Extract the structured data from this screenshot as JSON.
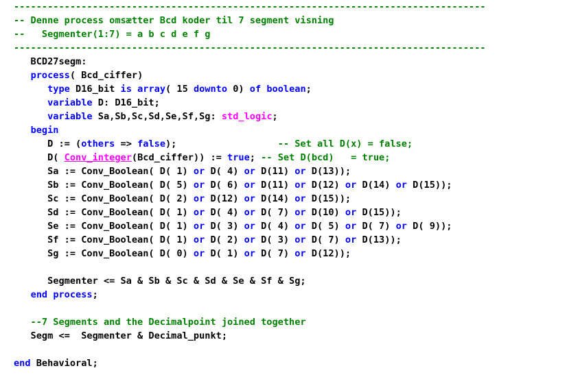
{
  "colors": {
    "plain": "#000000",
    "comment": "#008000",
    "keyword": "#0000ff",
    "type": "#ff00ff",
    "func": "#ff00ff"
  },
  "code_lines": [
    [
      {
        "t": "------------------------------------------------------------------------------------",
        "k": "comment"
      }
    ],
    [
      {
        "t": "-- Denne process omsætter Bcd koder til 7 segment visning",
        "k": "comment"
      }
    ],
    [
      {
        "t": "--   Segmenter(1:7) = a b c d e f g",
        "k": "comment"
      }
    ],
    [
      {
        "t": "------------------------------------------------------------------------------------",
        "k": "comment"
      }
    ],
    [
      {
        "t": "   BCD27segm:",
        "k": "plain"
      }
    ],
    [
      {
        "t": "   ",
        "k": "plain"
      },
      {
        "t": "process",
        "k": "keyword"
      },
      {
        "t": "( Bcd_ciffer)",
        "k": "plain"
      }
    ],
    [
      {
        "t": "      ",
        "k": "plain"
      },
      {
        "t": "type",
        "k": "keyword"
      },
      {
        "t": " D16_bit ",
        "k": "plain"
      },
      {
        "t": "is",
        "k": "keyword"
      },
      {
        "t": " ",
        "k": "plain"
      },
      {
        "t": "array",
        "k": "keyword"
      },
      {
        "t": "( 15 ",
        "k": "plain"
      },
      {
        "t": "downto",
        "k": "keyword"
      },
      {
        "t": " 0) ",
        "k": "plain"
      },
      {
        "t": "of",
        "k": "keyword"
      },
      {
        "t": " ",
        "k": "plain"
      },
      {
        "t": "boolean",
        "k": "keyword"
      },
      {
        "t": ";",
        "k": "plain"
      }
    ],
    [
      {
        "t": "      ",
        "k": "plain"
      },
      {
        "t": "variable",
        "k": "keyword"
      },
      {
        "t": " D: D16_bit;",
        "k": "plain"
      }
    ],
    [
      {
        "t": "      ",
        "k": "plain"
      },
      {
        "t": "variable",
        "k": "keyword"
      },
      {
        "t": " Sa,Sb,Sc,Sd,Se,Sf,Sg: ",
        "k": "plain"
      },
      {
        "t": "std_logic",
        "k": "type"
      },
      {
        "t": ";",
        "k": "plain"
      }
    ],
    [
      {
        "t": "   ",
        "k": "plain"
      },
      {
        "t": "begin",
        "k": "keyword"
      }
    ],
    [
      {
        "t": "      D := (",
        "k": "plain"
      },
      {
        "t": "others",
        "k": "keyword"
      },
      {
        "t": " => ",
        "k": "plain"
      },
      {
        "t": "false",
        "k": "keyword"
      },
      {
        "t": ");                  ",
        "k": "plain"
      },
      {
        "t": "-- Set all D(x) = false;",
        "k": "comment"
      }
    ],
    [
      {
        "t": "      D( ",
        "k": "plain"
      },
      {
        "t": "Conv_integer",
        "k": "func"
      },
      {
        "t": "(Bcd_ciffer)) := ",
        "k": "plain"
      },
      {
        "t": "true",
        "k": "keyword"
      },
      {
        "t": "; ",
        "k": "plain"
      },
      {
        "t": "-- Set D(bcd)   = true;",
        "k": "comment"
      }
    ],
    [
      {
        "t": "      Sa := Conv_Boolean( D( 1) ",
        "k": "plain"
      },
      {
        "t": "or",
        "k": "keyword"
      },
      {
        "t": " D( 4) ",
        "k": "plain"
      },
      {
        "t": "or",
        "k": "keyword"
      },
      {
        "t": " D(11) ",
        "k": "plain"
      },
      {
        "t": "or",
        "k": "keyword"
      },
      {
        "t": " D(13));",
        "k": "plain"
      }
    ],
    [
      {
        "t": "      Sb := Conv_Boolean( D( 5) ",
        "k": "plain"
      },
      {
        "t": "or",
        "k": "keyword"
      },
      {
        "t": " D( 6) ",
        "k": "plain"
      },
      {
        "t": "or",
        "k": "keyword"
      },
      {
        "t": " D(11) ",
        "k": "plain"
      },
      {
        "t": "or",
        "k": "keyword"
      },
      {
        "t": " D(12) ",
        "k": "plain"
      },
      {
        "t": "or",
        "k": "keyword"
      },
      {
        "t": " D(14) ",
        "k": "plain"
      },
      {
        "t": "or",
        "k": "keyword"
      },
      {
        "t": " D(15));",
        "k": "plain"
      }
    ],
    [
      {
        "t": "      Sc := Conv_Boolean( D( 2) ",
        "k": "plain"
      },
      {
        "t": "or",
        "k": "keyword"
      },
      {
        "t": " D(12) ",
        "k": "plain"
      },
      {
        "t": "or",
        "k": "keyword"
      },
      {
        "t": " D(14) ",
        "k": "plain"
      },
      {
        "t": "or",
        "k": "keyword"
      },
      {
        "t": " D(15));",
        "k": "plain"
      }
    ],
    [
      {
        "t": "      Sd := Conv_Boolean( D( 1) ",
        "k": "plain"
      },
      {
        "t": "or",
        "k": "keyword"
      },
      {
        "t": " D( 4) ",
        "k": "plain"
      },
      {
        "t": "or",
        "k": "keyword"
      },
      {
        "t": " D( 7) ",
        "k": "plain"
      },
      {
        "t": "or",
        "k": "keyword"
      },
      {
        "t": " D(10) ",
        "k": "plain"
      },
      {
        "t": "or",
        "k": "keyword"
      },
      {
        "t": " D(15));",
        "k": "plain"
      }
    ],
    [
      {
        "t": "      Se := Conv_Boolean( D( 1) ",
        "k": "plain"
      },
      {
        "t": "or",
        "k": "keyword"
      },
      {
        "t": " D( 3) ",
        "k": "plain"
      },
      {
        "t": "or",
        "k": "keyword"
      },
      {
        "t": " D( 4) ",
        "k": "plain"
      },
      {
        "t": "or",
        "k": "keyword"
      },
      {
        "t": " D( 5) ",
        "k": "plain"
      },
      {
        "t": "or",
        "k": "keyword"
      },
      {
        "t": " D( 7) ",
        "k": "plain"
      },
      {
        "t": "or",
        "k": "keyword"
      },
      {
        "t": " D( 9));",
        "k": "plain"
      }
    ],
    [
      {
        "t": "      Sf := Conv_Boolean( D( 1) ",
        "k": "plain"
      },
      {
        "t": "or",
        "k": "keyword"
      },
      {
        "t": " D( 2) ",
        "k": "plain"
      },
      {
        "t": "or",
        "k": "keyword"
      },
      {
        "t": " D( 3) ",
        "k": "plain"
      },
      {
        "t": "or",
        "k": "keyword"
      },
      {
        "t": " D( 7) ",
        "k": "plain"
      },
      {
        "t": "or",
        "k": "keyword"
      },
      {
        "t": " D(13));",
        "k": "plain"
      }
    ],
    [
      {
        "t": "      Sg := Conv_Boolean( D( 0) ",
        "k": "plain"
      },
      {
        "t": "or",
        "k": "keyword"
      },
      {
        "t": " D( 1) ",
        "k": "plain"
      },
      {
        "t": "or",
        "k": "keyword"
      },
      {
        "t": " D( 7) ",
        "k": "plain"
      },
      {
        "t": "or",
        "k": "keyword"
      },
      {
        "t": " D(12));",
        "k": "plain"
      }
    ],
    [],
    [
      {
        "t": "      Segmenter <= Sa & Sb & Sc & Sd & Se & Sf & Sg;",
        "k": "plain"
      }
    ],
    [
      {
        "t": "   ",
        "k": "plain"
      },
      {
        "t": "end",
        "k": "keyword"
      },
      {
        "t": " ",
        "k": "plain"
      },
      {
        "t": "process",
        "k": "keyword"
      },
      {
        "t": ";",
        "k": "plain"
      }
    ],
    [],
    [
      {
        "t": "   --7 Segments and the Decimalpoint joined together",
        "k": "comment"
      }
    ],
    [
      {
        "t": "   Segm <=  Segmenter & Decimal_punkt;",
        "k": "plain"
      }
    ],
    [],
    [
      {
        "t": "end",
        "k": "keyword"
      },
      {
        "t": " Behavioral;",
        "k": "plain"
      }
    ]
  ]
}
